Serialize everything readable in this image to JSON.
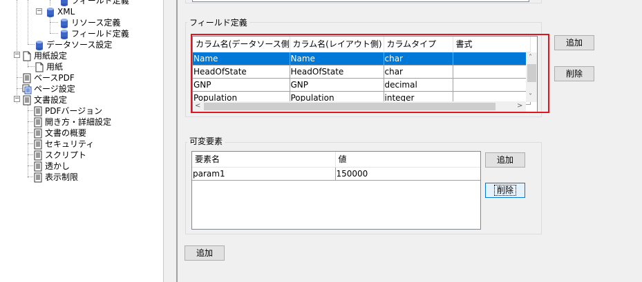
{
  "tree": {
    "items": [
      {
        "label": "フィールド定義",
        "icon": "database-icon"
      },
      {
        "label": "XML",
        "icon": "database-icon"
      },
      {
        "label": "リソース定義",
        "icon": "database-icon"
      },
      {
        "label": "フィールド定義",
        "icon": "database-icon"
      },
      {
        "label": "データソース設定",
        "icon": "database-icon"
      },
      {
        "label": "用紙設定",
        "icon": "page-icon"
      },
      {
        "label": "用紙",
        "icon": "page-icon"
      },
      {
        "label": "ベースPDF",
        "icon": "document-icon"
      },
      {
        "label": "ページ設定",
        "icon": "page-settings-icon"
      },
      {
        "label": "文書設定",
        "icon": "document-icon"
      },
      {
        "label": "PDFバージョン",
        "icon": "document-icon"
      },
      {
        "label": "開き方・詳細設定",
        "icon": "document-icon"
      },
      {
        "label": "文書の概要",
        "icon": "document-icon"
      },
      {
        "label": "セキュリティ",
        "icon": "document-icon"
      },
      {
        "label": "スクリプト",
        "icon": "document-icon"
      },
      {
        "label": "透かし",
        "icon": "document-icon"
      },
      {
        "label": "表示制限",
        "icon": "document-icon"
      }
    ]
  },
  "field_definition": {
    "title": "フィールド定義",
    "columns": [
      "カラム名(データソース側)",
      "カラム名(レイアウト側)",
      "カラムタイプ",
      "書式"
    ],
    "rows": [
      [
        "Name",
        "Name",
        "char",
        ""
      ],
      [
        "HeadOfState",
        "HeadOfState",
        "char",
        ""
      ],
      [
        "GNP",
        "GNP",
        "decimal",
        ""
      ],
      [
        "Population",
        "Population",
        "integer",
        ""
      ]
    ],
    "selected_row": 0,
    "add_label": "追加",
    "delete_label": "削除",
    "highlight_color": "#e0161e"
  },
  "variable_elements": {
    "title": "可変要素",
    "columns": [
      "要素名",
      "値"
    ],
    "rows": [
      [
        "param1",
        "150000"
      ]
    ],
    "add_label": "追加",
    "delete_label": "削除"
  },
  "bottom_add_label": "追加",
  "colors": {
    "selection": "#0078d7",
    "panel_bg": "#f0f0f0",
    "button_bg": "#e1e1e1"
  }
}
